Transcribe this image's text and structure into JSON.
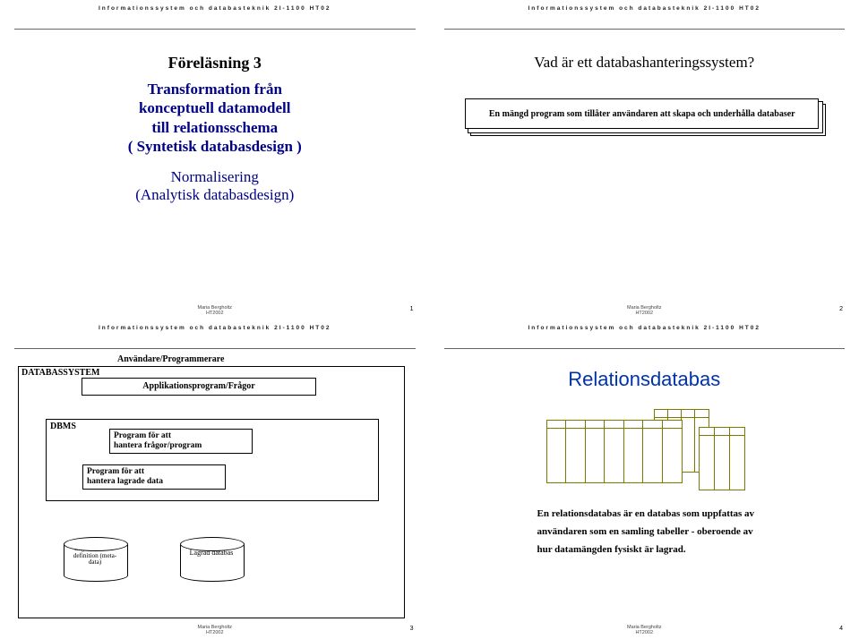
{
  "course_header": "Informationssystem och databasteknik 2I-1100 HT02",
  "footer": {
    "name": "Maria Bergholtz",
    "term": "HT2002"
  },
  "slide1": {
    "num": "1",
    "title": "Föreläsning 3",
    "sub_line1": "Transformation från",
    "sub_line2": "konceptuell datamodell",
    "sub_line3": "till relationsschema",
    "sub_line4": "( Syntetisk databasdesign )",
    "extra_line1": "Normalisering",
    "extra_line2": "(Analytisk databasdesign)"
  },
  "slide2": {
    "num": "2",
    "title": "Vad är ett databashanteringssystem?",
    "box": "En mängd program som tillåter användaren att skapa och underhålla databaser"
  },
  "slide3": {
    "num": "3",
    "outer_label": "DATABASSYSTEM",
    "users_label": "Användare/Programmerare",
    "app_box": "Applikationsprogram/Frågor",
    "dbms_label": "DBMS",
    "prog1_l1": "Program för att",
    "prog1_l2": "hantera frågor/program",
    "prog2_l1": "Program för att",
    "prog2_l2": "hantera lagrade data",
    "cyl1_l1": "Lagrad databas-",
    "cyl1_l2": "definition (meta-",
    "cyl1_l3": "data)",
    "cyl2": "Lagrad databas"
  },
  "slide4": {
    "num": "4",
    "title": "Relationsdatabas",
    "text_l1": "En relationsdatabas är en databas som uppfattas av",
    "text_l2": "användaren som en samling tabeller - oberoende av",
    "text_l3": "hur datamängden fysiskt är lagrad."
  }
}
